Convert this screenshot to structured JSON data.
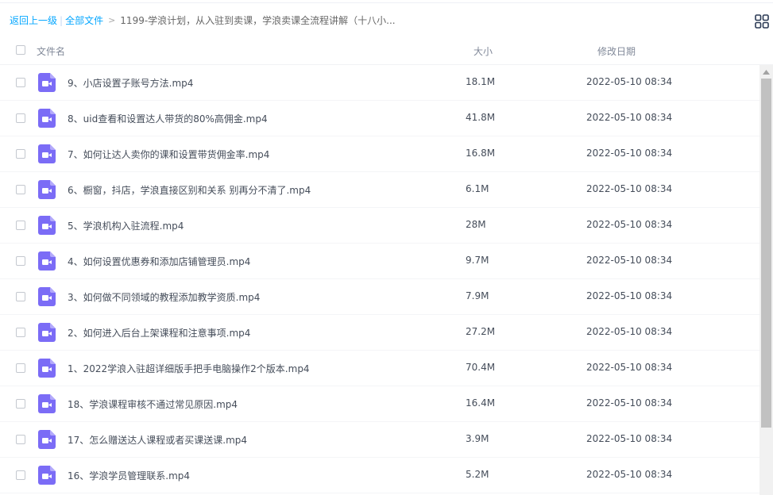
{
  "breadcrumb": {
    "back": "返回上一级",
    "separator": "|",
    "all_files": "全部文件",
    "arrow": ">",
    "current": "1199-学浪计划，从入驻到卖课，学浪卖课全流程讲解（十八小..."
  },
  "table": {
    "col_name": "文件名",
    "col_size": "大小",
    "col_date": "修改日期"
  },
  "files": [
    {
      "name": "9、小店设置子账号方法.mp4",
      "size": "18.1M",
      "date": "2022-05-10 08:34"
    },
    {
      "name": "8、uid查看和设置达人带货的80%高佣金.mp4",
      "size": "41.8M",
      "date": "2022-05-10 08:34"
    },
    {
      "name": "7、如何让达人卖你的课和设置带货佣金率.mp4",
      "size": "16.8M",
      "date": "2022-05-10 08:34"
    },
    {
      "name": "6、橱窗，抖店，学浪直接区别和关系 别再分不清了.mp4",
      "size": "6.1M",
      "date": "2022-05-10 08:34"
    },
    {
      "name": "5、学浪机构入驻流程.mp4",
      "size": "28M",
      "date": "2022-05-10 08:34"
    },
    {
      "name": "4、如何设置优惠券和添加店铺管理员.mp4",
      "size": "9.7M",
      "date": "2022-05-10 08:34"
    },
    {
      "name": "3、如何做不同领域的教程添加教学资质.mp4",
      "size": "7.9M",
      "date": "2022-05-10 08:34"
    },
    {
      "name": "2、如何进入后台上架课程和注意事项.mp4",
      "size": "27.2M",
      "date": "2022-05-10 08:34"
    },
    {
      "name": "1、2022学浪入驻超详细版手把手电脑操作2个版本.mp4",
      "size": "70.4M",
      "date": "2022-05-10 08:34"
    },
    {
      "name": "18、学浪课程审核不通过常见原因.mp4",
      "size": "16.4M",
      "date": "2022-05-10 08:34"
    },
    {
      "name": "17、怎么赠送达人课程或者买课送课.mp4",
      "size": "3.9M",
      "date": "2022-05-10 08:34"
    },
    {
      "name": "16、学浪学员管理联系.mp4",
      "size": "5.2M",
      "date": "2022-05-10 08:34"
    }
  ],
  "icons": {
    "file_type": "video-file-icon",
    "view_toggle": "grid-view-icon",
    "scroll_up": "scroll-up-arrow-icon"
  },
  "colors": {
    "link": "#06a7ff",
    "video_icon": "#7b6cf6",
    "text": "#454d5a",
    "header_text": "#818999"
  }
}
